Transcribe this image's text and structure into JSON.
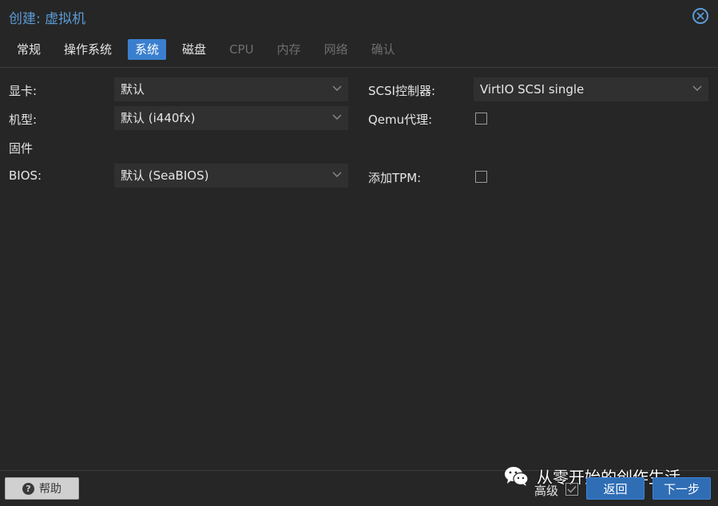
{
  "dialog": {
    "title": "创建: 虚拟机"
  },
  "tabs": [
    {
      "label": "常规",
      "state": "normal"
    },
    {
      "label": "操作系统",
      "state": "normal"
    },
    {
      "label": "系统",
      "state": "active"
    },
    {
      "label": "磁盘",
      "state": "normal"
    },
    {
      "label": "CPU",
      "state": "disabled"
    },
    {
      "label": "内存",
      "state": "disabled"
    },
    {
      "label": "网络",
      "state": "disabled"
    },
    {
      "label": "确认",
      "state": "disabled"
    }
  ],
  "form": {
    "graphics": {
      "label": "显卡:",
      "value": "默认"
    },
    "machine": {
      "label": "机型:",
      "value": "默认 (i440fx)"
    },
    "firmware": {
      "label": "固件"
    },
    "bios": {
      "label": "BIOS:",
      "value": "默认 (SeaBIOS)"
    },
    "scsi": {
      "label": "SCSI控制器:",
      "value": "VirtIO SCSI single"
    },
    "qemu_agent": {
      "label": "Qemu代理:",
      "checked": false
    },
    "tpm": {
      "label": "添加TPM:",
      "checked": false
    }
  },
  "footer": {
    "help_label": "帮助",
    "advanced_label": "高级",
    "advanced_checked": true,
    "back_label": "返回",
    "next_label": "下一步"
  },
  "watermark": {
    "text": "从零开始的创作生活"
  },
  "colors": {
    "accent": "#3a7fcf",
    "title": "#5b9bd5",
    "background": "#262626",
    "field": "#303030"
  }
}
